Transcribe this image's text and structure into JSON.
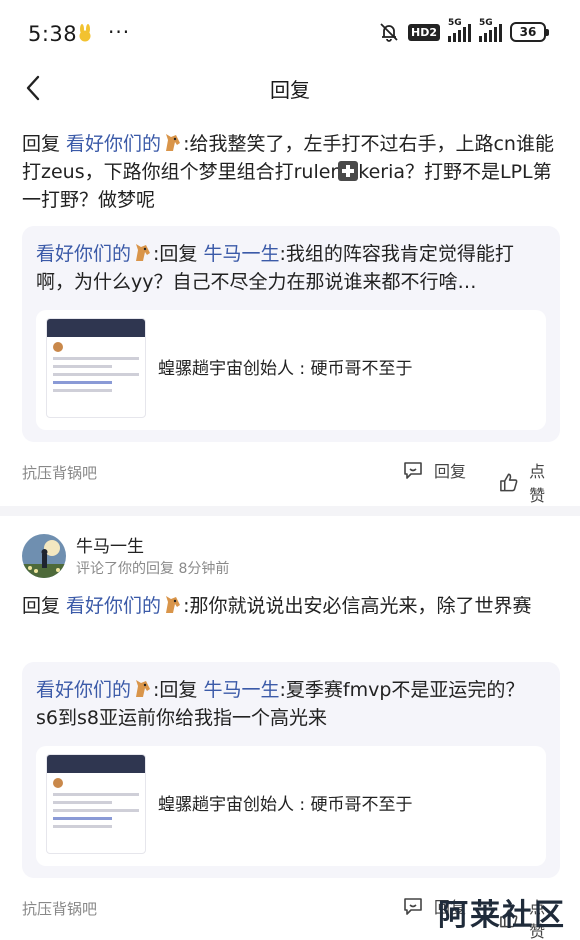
{
  "status_bar": {
    "time": "5:38",
    "dots": "···",
    "hd": "HD2",
    "net1": "5G",
    "net2": "5G",
    "battery": "36"
  },
  "nav": {
    "title": "回复"
  },
  "reply1": {
    "prefix": "回复 ",
    "to_user": "看好你们的",
    "text": ":给我整笑了，左手打不过右手，上路cn谁能打zeus，下路你组个梦里组合打ruler",
    "text2": "keria？打野不是LPL第一打野？做梦呢",
    "quote": {
      "user": "看好你们的",
      "mid": ":回复 ",
      "reply_to": "牛马一生",
      "text": ":我组的阵容我肯定觉得能打啊，为什么yy？自己不尽全力在那说谁来都不行啥…"
    },
    "card_text": "蝗骡趟宇宙创始人 : 硬币哥不至于",
    "footer": {
      "tag": "抗压背锅吧",
      "reply": "回复",
      "like": "点赞"
    }
  },
  "reply2": {
    "user": "牛马一生",
    "sub": "评论了你的回复  8分钟前",
    "prefix": "回复 ",
    "to_user": "看好你们的",
    "text": ":那你就说说出安必信高光来，除了世界赛",
    "quote": {
      "user": "看好你们的",
      "mid": ":回复 ",
      "reply_to": "牛马一生",
      "text": ":夏季赛fmvp不是亚运完的？s6到s8亚运前你给我指一个高光来"
    },
    "card_text": "蝗骡趟宇宙创始人 : 硬币哥不至于",
    "footer": {
      "tag": "抗压背锅吧",
      "reply": "回复",
      "like": "点赞"
    }
  },
  "watermark": "阿莱社区"
}
